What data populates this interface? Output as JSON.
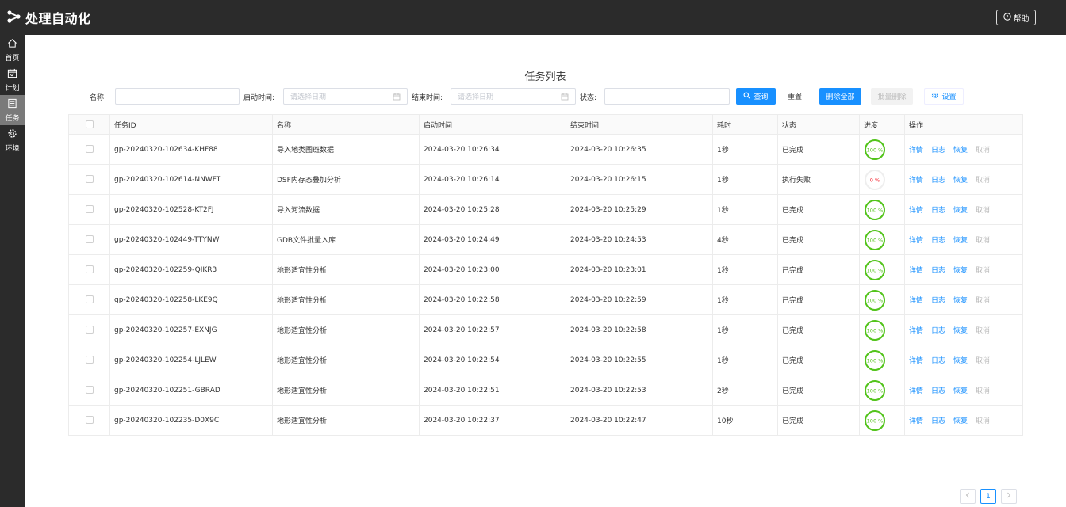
{
  "app": {
    "title": "处理自动化",
    "help_label": "帮助"
  },
  "sidebar": {
    "items": [
      {
        "label": "首页",
        "icon": "home-icon",
        "active": false
      },
      {
        "label": "计划",
        "icon": "calendar-icon",
        "active": false
      },
      {
        "label": "任务",
        "icon": "list-icon",
        "active": true
      },
      {
        "label": "环境",
        "icon": "gear-icon",
        "active": false
      }
    ]
  },
  "page": {
    "title": "任务列表"
  },
  "filters": {
    "name_label": "名称:",
    "name_value": "",
    "start_label": "启动时间:",
    "start_placeholder": "请选择日期",
    "end_label": "结束时间:",
    "end_placeholder": "请选择日期",
    "status_label": "状态:",
    "status_value": ""
  },
  "toolbar": {
    "query_label": "查询",
    "reset_label": "重置",
    "delete_all_label": "删除全部",
    "batch_delete_label": "批量删除",
    "settings_label": "设置"
  },
  "table": {
    "columns": [
      "任务ID",
      "名称",
      "启动时间",
      "结束时间",
      "耗时",
      "状态",
      "进度",
      "操作"
    ],
    "actions": [
      "详情",
      "日志",
      "恢复",
      "取消"
    ],
    "rows": [
      {
        "id": "gp-20240320-102634-KHF88",
        "name": "导入地类图斑数据",
        "start": "2024-03-20 10:26:34",
        "end": "2024-03-20 10:26:35",
        "duration": "1秒",
        "status": "已完成",
        "progress": 100,
        "progress_label": "100 %"
      },
      {
        "id": "gp-20240320-102614-NNWFT",
        "name": "DSF内存态叠加分析",
        "start": "2024-03-20 10:26:14",
        "end": "2024-03-20 10:26:15",
        "duration": "1秒",
        "status": "执行失败",
        "progress": 0,
        "progress_label": "0 %"
      },
      {
        "id": "gp-20240320-102528-KT2FJ",
        "name": "导入河流数据",
        "start": "2024-03-20 10:25:28",
        "end": "2024-03-20 10:25:29",
        "duration": "1秒",
        "status": "已完成",
        "progress": 100,
        "progress_label": "100 %"
      },
      {
        "id": "gp-20240320-102449-TTYNW",
        "name": "GDB文件批量入库",
        "start": "2024-03-20 10:24:49",
        "end": "2024-03-20 10:24:53",
        "duration": "4秒",
        "status": "已完成",
        "progress": 100,
        "progress_label": "100 %"
      },
      {
        "id": "gp-20240320-102259-QIKR3",
        "name": "地形适宜性分析",
        "start": "2024-03-20 10:23:00",
        "end": "2024-03-20 10:23:01",
        "duration": "1秒",
        "status": "已完成",
        "progress": 100,
        "progress_label": "100 %"
      },
      {
        "id": "gp-20240320-102258-LKE9Q",
        "name": "地形适宜性分析",
        "start": "2024-03-20 10:22:58",
        "end": "2024-03-20 10:22:59",
        "duration": "1秒",
        "status": "已完成",
        "progress": 100,
        "progress_label": "100 %"
      },
      {
        "id": "gp-20240320-102257-EXNJG",
        "name": "地形适宜性分析",
        "start": "2024-03-20 10:22:57",
        "end": "2024-03-20 10:22:58",
        "duration": "1秒",
        "status": "已完成",
        "progress": 100,
        "progress_label": "100 %"
      },
      {
        "id": "gp-20240320-102254-LJLEW",
        "name": "地形适宜性分析",
        "start": "2024-03-20 10:22:54",
        "end": "2024-03-20 10:22:55",
        "duration": "1秒",
        "status": "已完成",
        "progress": 100,
        "progress_label": "100 %"
      },
      {
        "id": "gp-20240320-102251-GBRAD",
        "name": "地形适宜性分析",
        "start": "2024-03-20 10:22:51",
        "end": "2024-03-20 10:22:53",
        "duration": "2秒",
        "status": "已完成",
        "progress": 100,
        "progress_label": "100 %"
      },
      {
        "id": "gp-20240320-102235-D0X9C",
        "name": "地形适宜性分析",
        "start": "2024-03-20 10:22:37",
        "end": "2024-03-20 10:22:47",
        "duration": "10秒",
        "status": "已完成",
        "progress": 100,
        "progress_label": "100 %"
      }
    ]
  },
  "pagination": {
    "current_page": "1",
    "prev_icon": "chevron-left-icon",
    "next_icon": "chevron-right-icon"
  },
  "colors": {
    "header_bg": "#2b2b2b",
    "accent": "#1890ff",
    "success": "#52c41a",
    "error": "#f5222d"
  }
}
